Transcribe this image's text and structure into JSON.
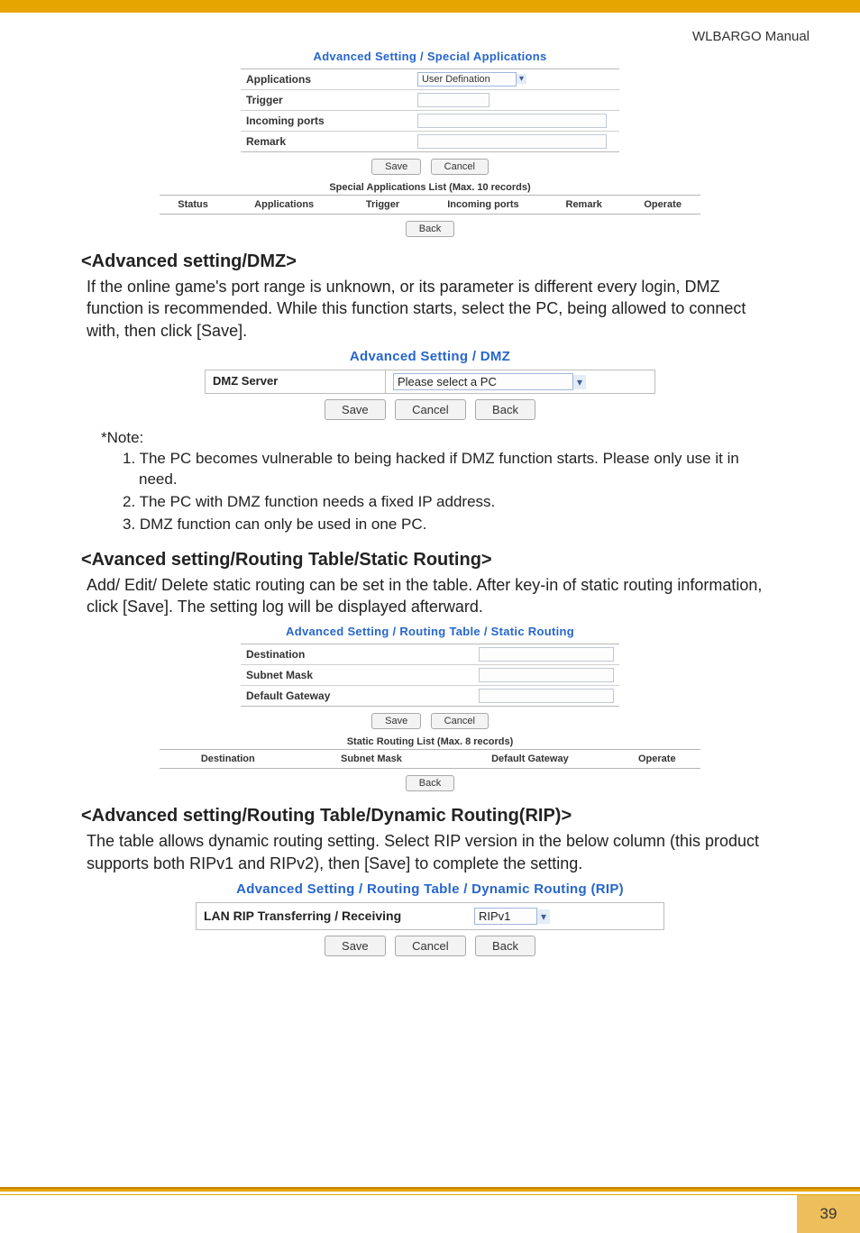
{
  "header_right": "WLBARGO Manual",
  "specApps": {
    "title": "Advanced Setting / Special Applications",
    "row_applications_label": "Applications",
    "row_applications_select": "User Defination",
    "row_trigger_label": "Trigger",
    "row_incoming_label": "Incoming ports",
    "row_remark_label": "Remark",
    "save": "Save",
    "cancel": "Cancel",
    "list_caption": "Special Applications List (Max. 10 records)",
    "cols": {
      "status": "Status",
      "applications": "Applications",
      "trigger": "Trigger",
      "incoming": "Incoming ports",
      "remark": "Remark",
      "operate": "Operate"
    },
    "back": "Back"
  },
  "dmz": {
    "heading": "<Advanced setting/DMZ>",
    "para": "If the online game's port range is unknown, or its parameter is different every login, DMZ function is recommended. While this function starts, select the PC, being allowed to connect with, then click [Save].",
    "title": "Advanced Setting / DMZ",
    "label": "DMZ Server",
    "select_value": "Please select a PC",
    "save": "Save",
    "cancel": "Cancel",
    "back": "Back",
    "note_label": "*Note:",
    "notes": [
      "1. The PC becomes vulnerable to being hacked if DMZ function starts.  Please only use it in need.",
      "2. The PC with DMZ function needs a fixed IP address.",
      "3. DMZ function can only be used in one PC."
    ]
  },
  "staticR": {
    "heading": "<Avanced setting/Routing Table/Static Routing>",
    "para": "Add/ Edit/ Delete static routing can be set in the table.  After key-in of static routing information, click [Save].  The setting log will be displayed afterward.",
    "title": "Advanced Setting / Routing Table / Static Routing",
    "row_dest": "Destination",
    "row_mask": "Subnet Mask",
    "row_gw": "Default Gateway",
    "save": "Save",
    "cancel": "Cancel",
    "list_caption": "Static Routing List (Max. 8 records)",
    "cols": {
      "dest": "Destination",
      "mask": "Subnet Mask",
      "gw": "Default Gateway",
      "operate": "Operate"
    },
    "back": "Back"
  },
  "rip": {
    "heading": "<Advanced setting/Routing Table/Dynamic Routing(RIP)>",
    "para": "The table allows dynamic routing setting.  Select RIP version in the below column (this product supports both RIPv1 and RIPv2), then [Save] to complete the setting.",
    "title": "Advanced Setting / Routing Table / Dynamic Routing (RIP)",
    "label": "LAN RIP Transferring / Receiving",
    "select_value": "RIPv1",
    "save": "Save",
    "cancel": "Cancel",
    "back": "Back"
  },
  "page_number": "39"
}
